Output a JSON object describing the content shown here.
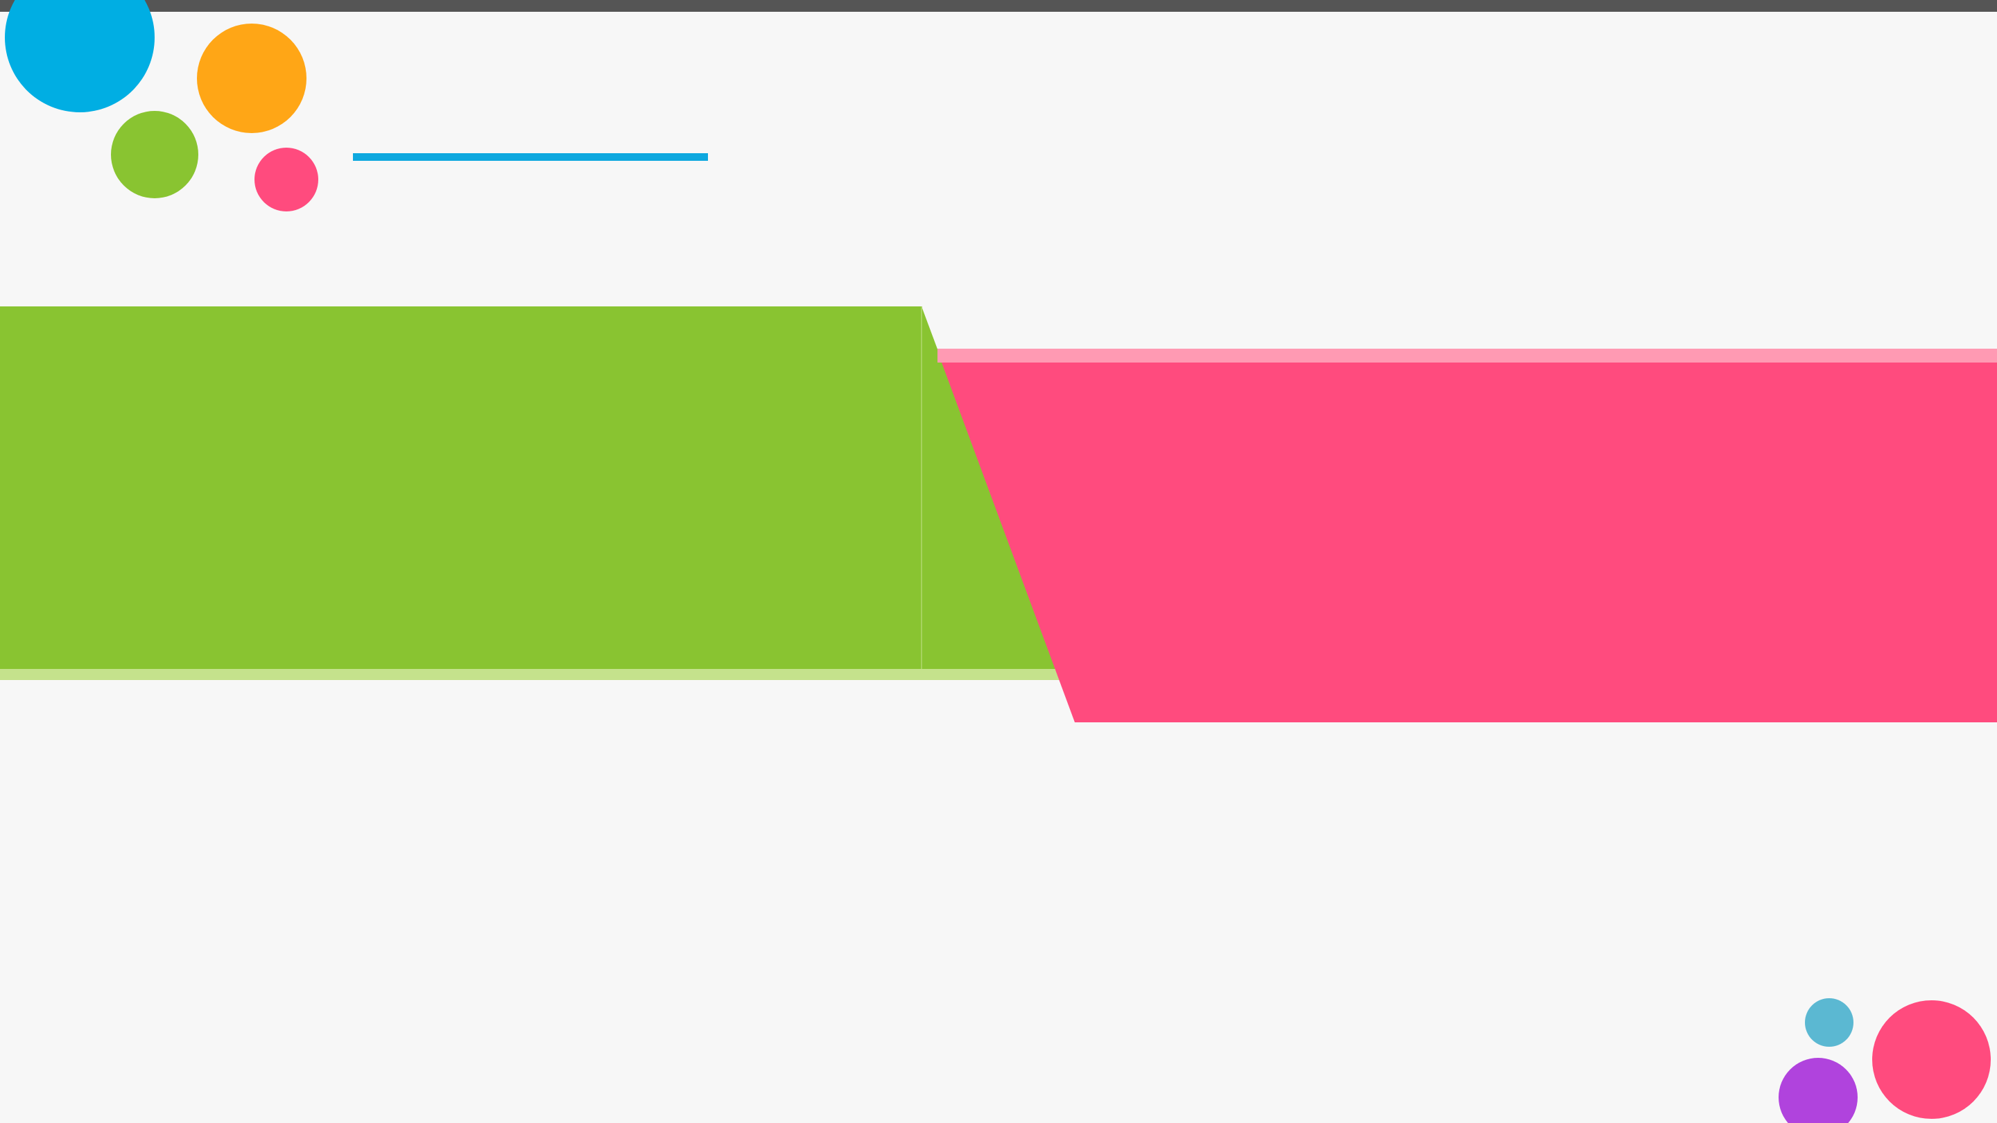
{
  "slide": {
    "title": "",
    "subtitle": ""
  },
  "colors": {
    "background": "#f7f7f7",
    "top_bar": "#555555",
    "blue": "#00aee3",
    "orange": "#ffa616",
    "green": "#89c431",
    "green_light": "#c5e28c",
    "pink": "#ff4b7e",
    "pink_light": "#ff9ab3",
    "teal": "#5bb8d2",
    "purple": "#b043dd",
    "accent_line": "#0ea8df"
  },
  "decorations": [
    {
      "name": "circle-blue-large",
      "color": "blue"
    },
    {
      "name": "circle-orange",
      "color": "orange"
    },
    {
      "name": "circle-green",
      "color": "green"
    },
    {
      "name": "circle-pink-small",
      "color": "pink"
    },
    {
      "name": "circle-teal-small",
      "color": "teal"
    },
    {
      "name": "circle-pink-large",
      "color": "pink"
    },
    {
      "name": "circle-purple",
      "color": "purple"
    }
  ]
}
